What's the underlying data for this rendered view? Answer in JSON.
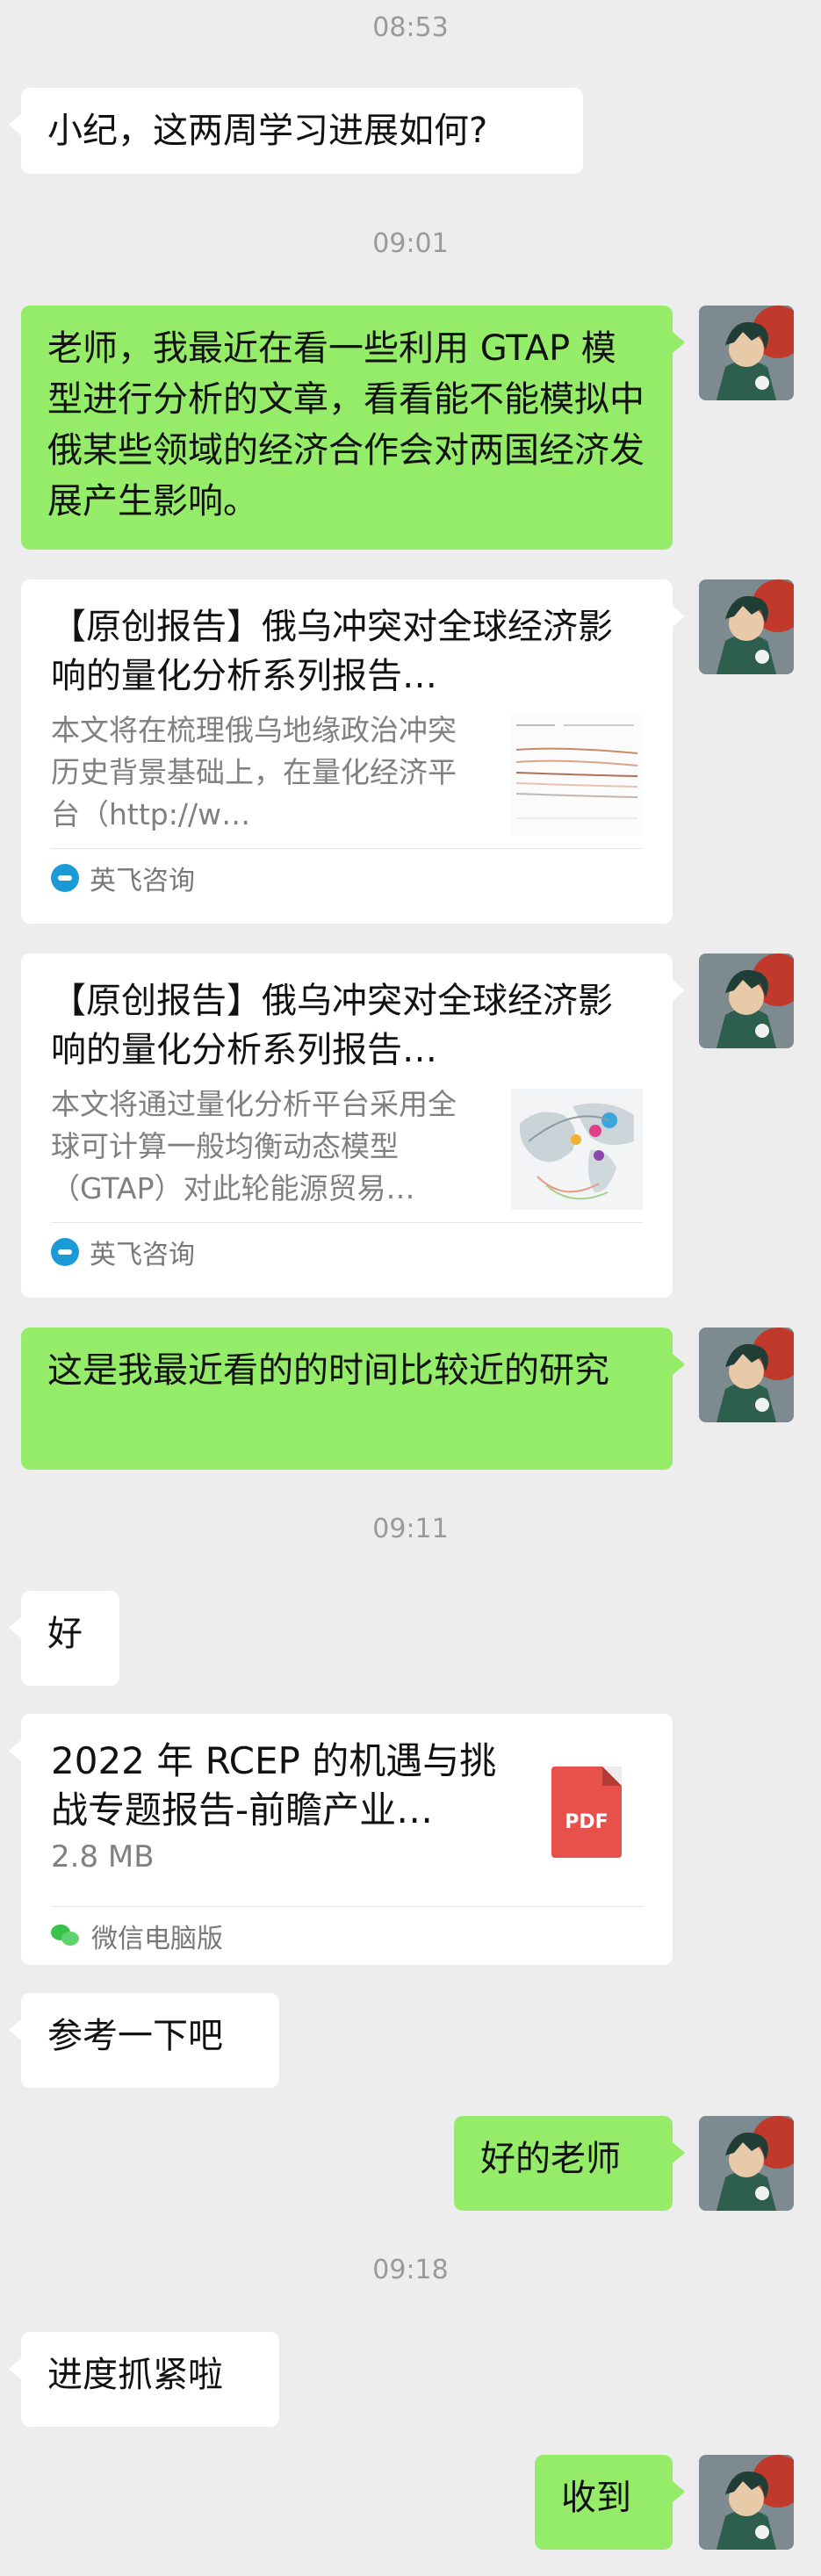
{
  "messages": {
    "t1": "08:53",
    "m1": "小纪，这两周学习进展如何?",
    "t2": "09:01",
    "m2": "老师，我最近在看一些利用 GTAP 模型进行分析的文章，看看能不能模拟中俄某些领域的经济合作会对两国经济发展产生影响。",
    "card1": {
      "title": "【原创报告】俄乌冲突对全球经济影响的量化分析系列报告…",
      "desc": "本文将在梳理俄乌地缘政治冲突历史背景基础上，在量化经济平台（http://w…",
      "source": "英飞咨询"
    },
    "card2": {
      "title": "【原创报告】俄乌冲突对全球经济影响的量化分析系列报告…",
      "desc": "本文将通过量化分析平台采用全球可计算一般均衡动态模型（GTAP）对此轮能源贸易…",
      "source": "英飞咨询"
    },
    "m3": "这是我最近看的的时间比较近的研究",
    "t3": "09:11",
    "m4": "好",
    "file": {
      "title": "2022 年 RCEP 的机遇与挑战专题报告-前瞻产业…",
      "size": "2.8 MB",
      "icon_label": "PDF",
      "source": "微信电脑版"
    },
    "m5": "参考一下吧",
    "m6": "好的老师",
    "t4": "09:18",
    "m7": "进度抓紧啦",
    "m8": "收到"
  },
  "icons": {
    "avatar": "user-avatar-anime-character",
    "source": "yingfei-logo-icon",
    "pdf": "pdf-file-icon",
    "wechat": "wechat-icon"
  },
  "colors": {
    "background": "#ededed",
    "outgoing_bubble": "#95ec69",
    "incoming_bubble": "#ffffff",
    "timestamp": "#9a9a9a",
    "pdf": "#e8514b"
  }
}
